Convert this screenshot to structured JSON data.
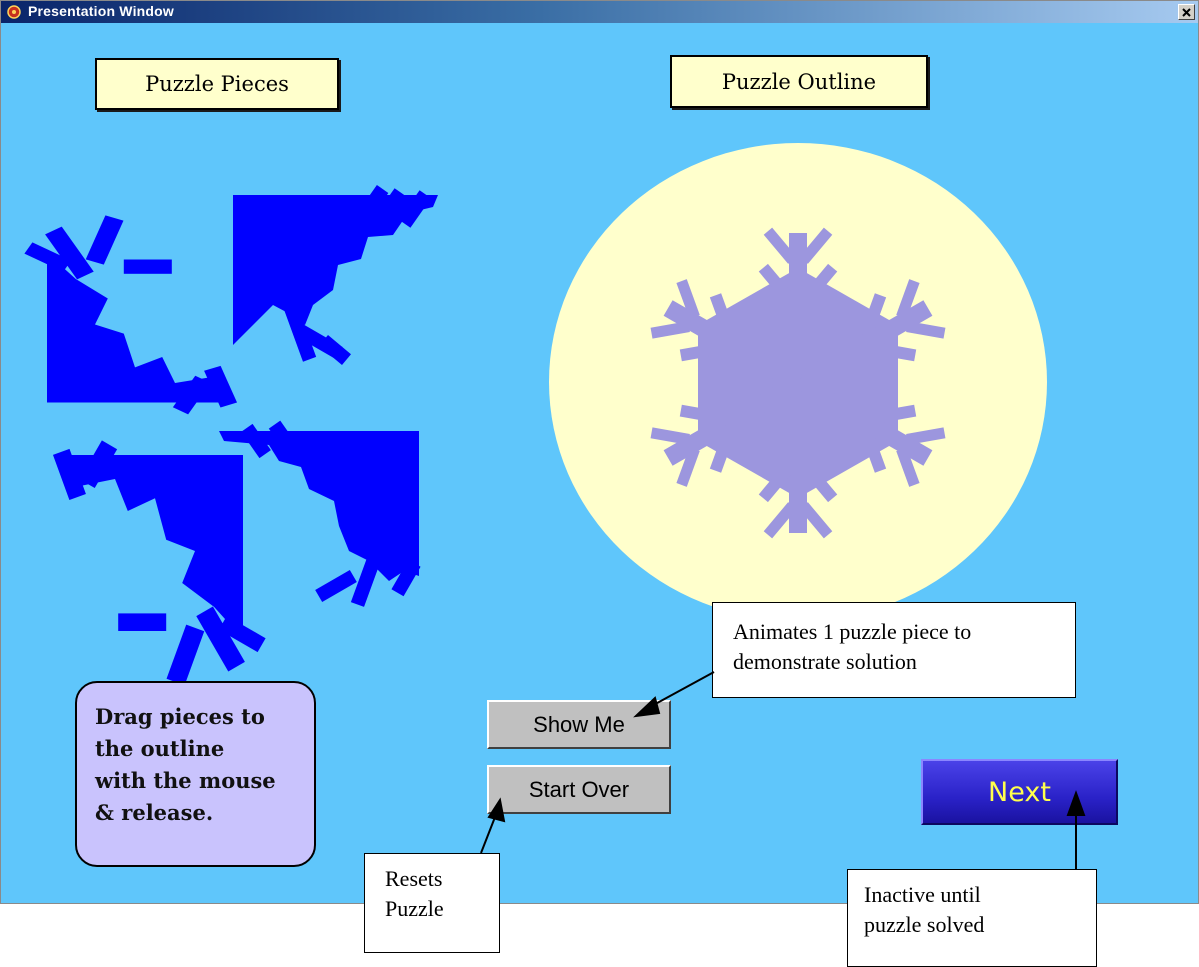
{
  "window": {
    "title": "Presentation Window"
  },
  "labels": {
    "pieces_title": "Puzzle Pieces",
    "outline_title": "Puzzle Outline"
  },
  "instructions": {
    "text": "Drag pieces to\nthe outline\nwith the mouse\n& release."
  },
  "buttons": {
    "show_me": "Show Me",
    "start_over": "Start Over",
    "next": "Next"
  },
  "callouts": {
    "show_me": "Animates 1 puzzle piece to\ndemonstrate solution",
    "start_over": "Resets\nPuzzle",
    "next": "Inactive until\npuzzle solved"
  },
  "colors": {
    "background": "#5fc6fb",
    "piece": "#0000ff",
    "outline_fill": "#9c96de",
    "circle": "#ffffcc",
    "instructions_bg": "#c9c3fd",
    "next_text": "#ffff4d"
  },
  "icons": {
    "app": "app-icon",
    "close": "close-icon"
  }
}
